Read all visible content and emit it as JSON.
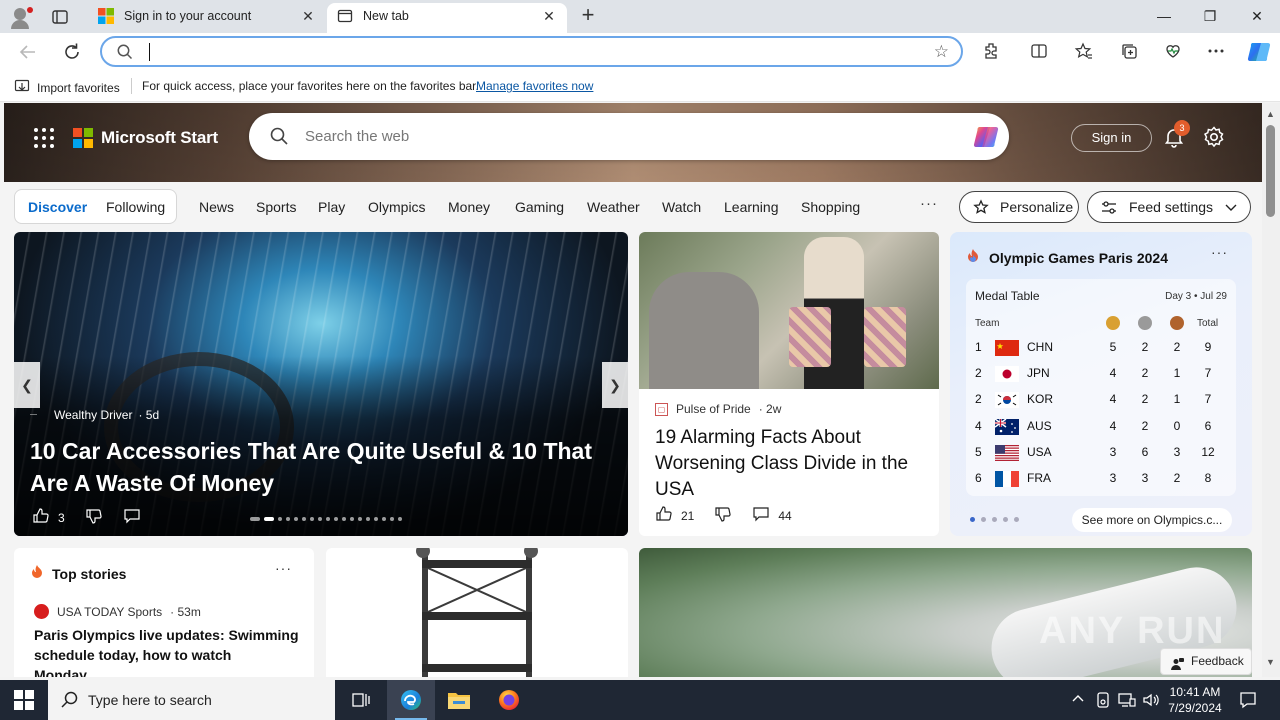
{
  "browser": {
    "tabs": [
      {
        "title": "Sign in to your account",
        "active": false
      },
      {
        "title": "New tab",
        "active": true
      }
    ],
    "close_glyph": "✕",
    "newtab_glyph": "+",
    "window_controls": {
      "minimize": "—",
      "restore": "❐",
      "close": "✕"
    },
    "address": {
      "value": "",
      "placeholder": ""
    },
    "favorites_bar": {
      "import_label": "Import favorites",
      "hint": "For quick access, place your favorites here on the favorites bar.",
      "manage_link": "Manage favorites now"
    }
  },
  "msn": {
    "brand": "Microsoft Start",
    "search_placeholder": "Search the web",
    "sign_in": "Sign in",
    "notification_count": "3",
    "segments": {
      "discover": "Discover",
      "following": "Following"
    },
    "nav": [
      "News",
      "Sports",
      "Play",
      "Olympics",
      "Money",
      "Gaming",
      "Weather",
      "Watch",
      "Learning",
      "Shopping"
    ],
    "nav_more": "···",
    "personalize": "Personalize",
    "feed_settings": "Feed settings",
    "main_story": {
      "source": "Wealthy Driver",
      "age": "· 5d",
      "headline": "10 Car Accessories That Are Quite Useful & 10 That Are A Waste Of Money",
      "likes": "3",
      "carousel_count": 18,
      "carousel_active": 1
    },
    "story2": {
      "source": "Pulse of Pride",
      "age": "· 2w",
      "headline": "19 Alarming Facts About Worsening Class Divide in the USA",
      "likes": "21",
      "comments": "44"
    },
    "olympics": {
      "title": "Olympic Games Paris 2024",
      "more": "···",
      "medal_table_title": "Medal Table",
      "day": "Day 3 • Jul 29",
      "header": {
        "team": "Team",
        "total": "Total"
      },
      "medal_colors": {
        "gold": "#d9a032",
        "silver": "#9a9a9a",
        "bronze": "#b0632d"
      },
      "rows": [
        {
          "rank": "1",
          "team": "CHN",
          "gold": "5",
          "silver": "2",
          "bronze": "2",
          "total": "9"
        },
        {
          "rank": "2",
          "team": "JPN",
          "gold": "4",
          "silver": "2",
          "bronze": "1",
          "total": "7"
        },
        {
          "rank": "2",
          "team": "KOR",
          "gold": "4",
          "silver": "2",
          "bronze": "1",
          "total": "7"
        },
        {
          "rank": "4",
          "team": "AUS",
          "gold": "4",
          "silver": "2",
          "bronze": "0",
          "total": "6"
        },
        {
          "rank": "5",
          "team": "USA",
          "gold": "3",
          "silver": "6",
          "bronze": "3",
          "total": "12"
        },
        {
          "rank": "6",
          "team": "FRA",
          "gold": "3",
          "silver": "3",
          "bronze": "2",
          "total": "8"
        }
      ],
      "see_more": "See more on Olympics.c..."
    },
    "top_stories": {
      "title": "Top stories",
      "more": "···",
      "source": "USA TODAY Sports",
      "age": "· 53m",
      "headline": "Paris Olympics live updates: Swimming schedule today, how to watch Monday,..."
    },
    "feedback": "Feedback",
    "watermark": "ANY RUN"
  },
  "taskbar": {
    "search_placeholder": "Type here to search",
    "time": "10:41 AM",
    "date": "7/29/2024"
  },
  "colors": {
    "accent": "#0b6bcb",
    "address_focus": "#6ba6e9",
    "taskbar": "#1f2734"
  }
}
